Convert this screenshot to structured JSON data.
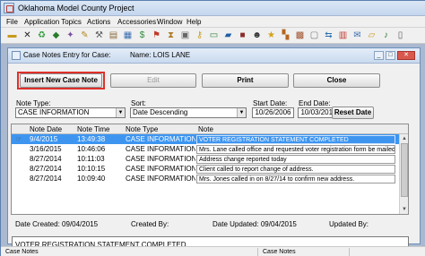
{
  "window": {
    "title": "Oklahoma Model County Project"
  },
  "menu": [
    {
      "label": "File"
    },
    {
      "label": "Application Topics"
    },
    {
      "label": "Actions"
    },
    {
      "label": "Accessories"
    },
    {
      "label": "Window"
    },
    {
      "label": "Help"
    }
  ],
  "toolbar_icons": [
    "folder-icon",
    "close-icon",
    "recycle-icon",
    "tag-icon",
    "wand-icon",
    "pencil-icon",
    "wrench-icon",
    "scroll-icon",
    "calculator-icon",
    "dollar-icon",
    "flag-icon",
    "hourglass-icon",
    "clipboard-icon",
    "key-icon",
    "cash-icon",
    "card-icon",
    "book-icon",
    "person-icon",
    "star-icon",
    "blocks-icon",
    "box-icon",
    "paper-icon",
    "arrows-icon",
    "chart-icon",
    "mail-icon",
    "folder-open-icon",
    "note-icon",
    "document-icon"
  ],
  "child_window": {
    "title": "Case Notes Entry for Case:",
    "case_name": "Name: LOIS  LANE"
  },
  "buttons": {
    "insert": "Insert New Case Note",
    "edit": "Edit",
    "print": "Print",
    "close": "Close",
    "reset_date": "Reset Date"
  },
  "filters": {
    "note_type_label": "Note Type:",
    "note_type_value": "CASE INFORMATION",
    "sort_label": "Sort:",
    "sort_value": "Date Descending",
    "start_date_label": "Start Date:",
    "start_date_value": "10/26/2006",
    "end_date_label": "End Date:",
    "end_date_value": "10/03/2018"
  },
  "grid": {
    "columns": [
      "Note Date",
      "Note Time",
      "Note Type",
      "Note"
    ],
    "rows": [
      {
        "date": "9/4/2015",
        "time": "13:49:38",
        "type": "CASE INFORMATION",
        "note": "VOTER REGISTRATION STATEMENT COMPLETED",
        "selected": true
      },
      {
        "date": "3/16/2015",
        "time": "10:46:06",
        "type": "CASE INFORMATION",
        "note": "Mrs. Lane called office and requested voter registration form be mailed to her.",
        "selected": false
      },
      {
        "date": "8/27/2014",
        "time": "10:11:03",
        "type": "CASE INFORMATION",
        "note": "Address change reported today",
        "selected": false
      },
      {
        "date": "8/27/2014",
        "time": "10:10:15",
        "type": "CASE INFORMATION",
        "note": "Client called to report change of address.",
        "selected": false
      },
      {
        "date": "8/27/2014",
        "time": "10:09:40",
        "type": "CASE INFORMATION",
        "note": "Mrs. Jones called in on 8/27/14 to confirm new address.",
        "selected": false
      }
    ]
  },
  "detail": {
    "date_created_label": "Date Created:",
    "date_created_value": "09/04/2015",
    "created_by_label": "Created By:",
    "date_updated_label": "Date Updated:",
    "date_updated_value": "09/04/2015",
    "updated_by_label": "Updated By:",
    "note_text": "VOTER REGISTRATION STATEMENT COMPLETED"
  },
  "status_bar": {
    "left": "Case Notes",
    "middle": "Case Notes"
  },
  "colors": {
    "selection": "#3d95f0",
    "highlight_border": "#e0302a",
    "mdi_background": "#aab9cf"
  }
}
